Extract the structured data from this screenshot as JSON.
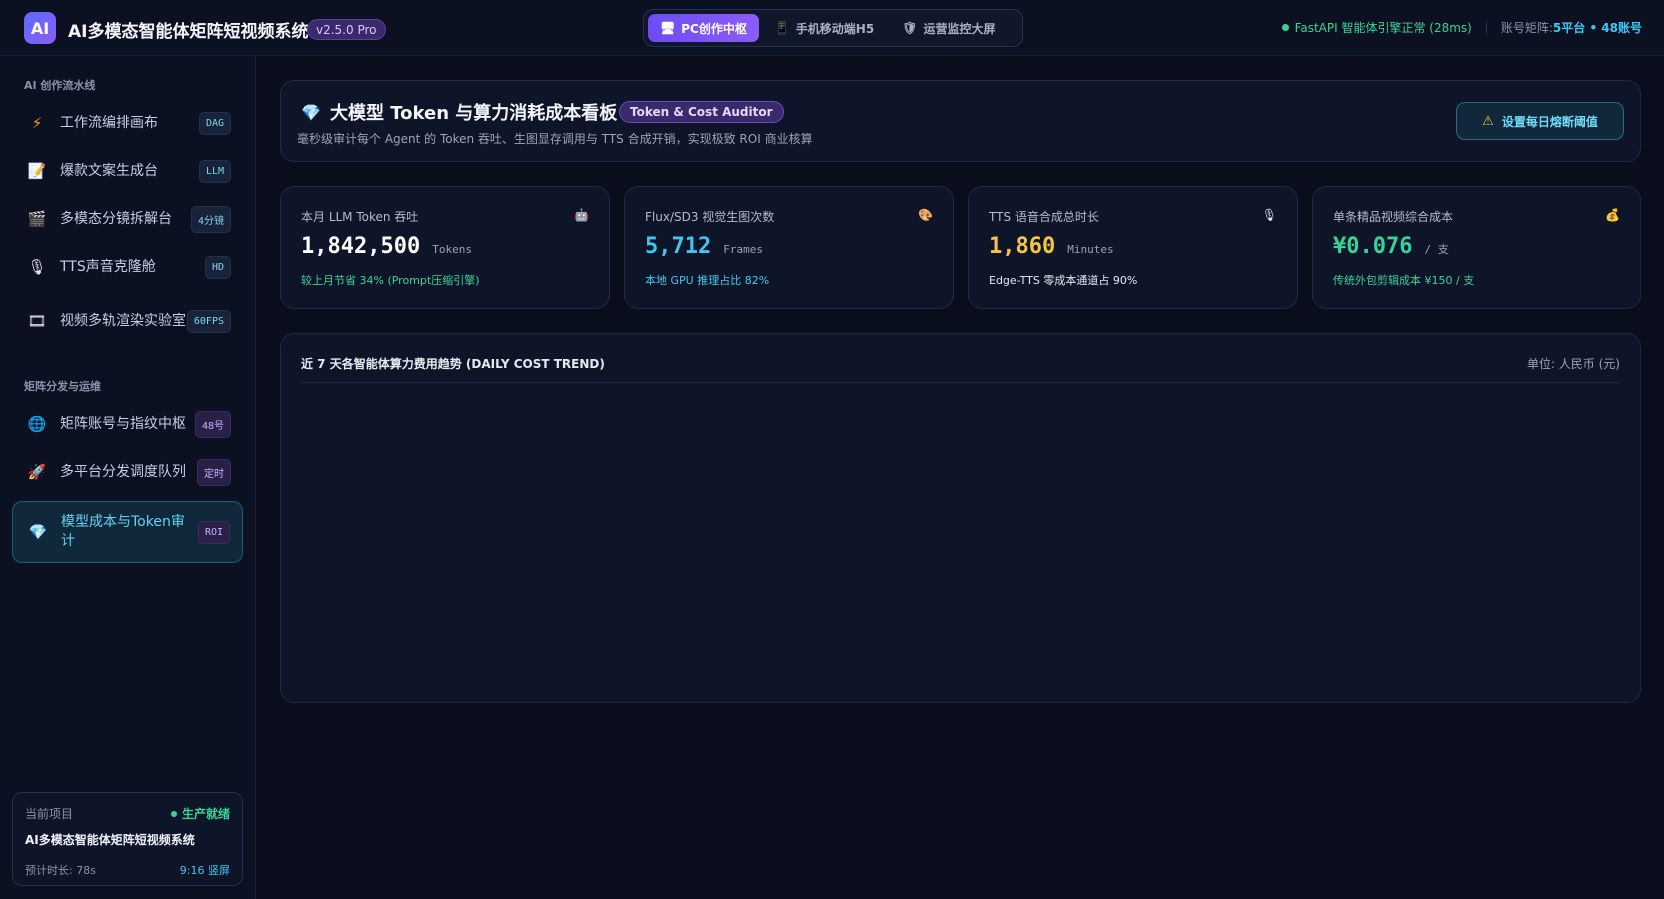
{
  "header": {
    "logo_text": "AI",
    "app_title": "AI多模态智能体矩阵短视频系统",
    "version": "v2.5.0 Pro",
    "modes": [
      {
        "label": "PC创作中枢",
        "icon": "monitor-icon",
        "glyph": "🖥",
        "active": true
      },
      {
        "label": "手机移动端H5",
        "icon": "phone-icon",
        "glyph": "📱",
        "active": false
      },
      {
        "label": "运营监控大屏",
        "icon": "shield-icon",
        "glyph": "🛡",
        "active": false
      }
    ],
    "engine_status": "FastAPI 智能体引擎正常 (28ms)",
    "account_label": "账号矩阵:",
    "account_value": "5平台 • 48账号"
  },
  "sidebar": {
    "section1": "AI 创作流水线",
    "section2": "矩阵分发与运维",
    "items": [
      {
        "label": "工作流编排画布",
        "badge": "DAG",
        "icon": "lightning-icon",
        "glyph": "⚡"
      },
      {
        "label": "爆款文案生成台",
        "badge": "LLM",
        "icon": "document-icon",
        "glyph": "📝"
      },
      {
        "label": "多模态分镜拆解台",
        "badge": "4分镜",
        "icon": "clapper-icon",
        "glyph": "🎬"
      },
      {
        "label": "TTS声音克隆舱",
        "badge": "HD",
        "icon": "microphone-icon",
        "glyph": "🎙"
      },
      {
        "label": "视频多轨渲染实验室",
        "badge": "60FPS",
        "icon": "film-icon",
        "glyph": "🎞"
      },
      {
        "label": "矩阵账号与指纹中枢",
        "badge": "48号",
        "icon": "globe-icon",
        "glyph": "🌐"
      },
      {
        "label": "多平台分发调度队列",
        "badge": "定时",
        "icon": "rocket-icon",
        "glyph": "🚀"
      },
      {
        "label": "模型成本与Token审计",
        "badge": "ROI",
        "icon": "gem-icon",
        "glyph": "💎"
      }
    ],
    "project": {
      "label": "当前项目",
      "status": "生产就绪",
      "name": "AI多模态智能体矩阵短视频系统",
      "duration": "预计时长: 78s",
      "ratio": "9:16 竖屏"
    }
  },
  "main": {
    "title_icon": "💎",
    "title": "大模型 Token 与算力消耗成本看板",
    "tag": "Token & Cost Auditor",
    "subtitle": "毫秒级审计每个 Agent 的 Token 吞吐、生图显存调用与 TTS 合成开销，实现极致 ROI 商业核算",
    "threshold_button": "设置每日熔断阈值",
    "stats": [
      {
        "label": "本月 LLM Token 吞吐",
        "value": "1,842,500",
        "unit": "Tokens",
        "note": "较上月节省 34% (Prompt压缩引擎)",
        "icon": "robot-icon",
        "glyph": "🤖",
        "value_color": "#ffffff",
        "note_color": "#37d399"
      },
      {
        "label": "Flux/SD3 视觉生图次数",
        "value": "5,712",
        "unit": "Frames",
        "note": "本地 GPU 推理占比 82%",
        "icon": "palette-icon",
        "glyph": "🎨",
        "value_color": "#3ec7f0",
        "note_color": "#3ec7f0"
      },
      {
        "label": "TTS 语音合成总时长",
        "value": "1,860",
        "unit": "Minutes",
        "note": "Edge-TTS 零成本通道占 90%",
        "icon": "microphone-icon",
        "glyph": "🎙",
        "value_color": "#f5c542",
        "note_color": "#e6e9f2"
      },
      {
        "label": "单条精品视频综合成本",
        "value": "¥0.076",
        "unit": "/ 支",
        "note": "传统外包剪辑成本 ¥150 / 支",
        "icon": "money-bag-icon",
        "glyph": "💰",
        "value_color": "#37d399",
        "note_color": "#37d399"
      }
    ],
    "chart": {
      "title": "近 7 天各智能体算力费用趋势 (DAILY COST TREND)",
      "unit": "单位: 人民币 (元)"
    }
  }
}
